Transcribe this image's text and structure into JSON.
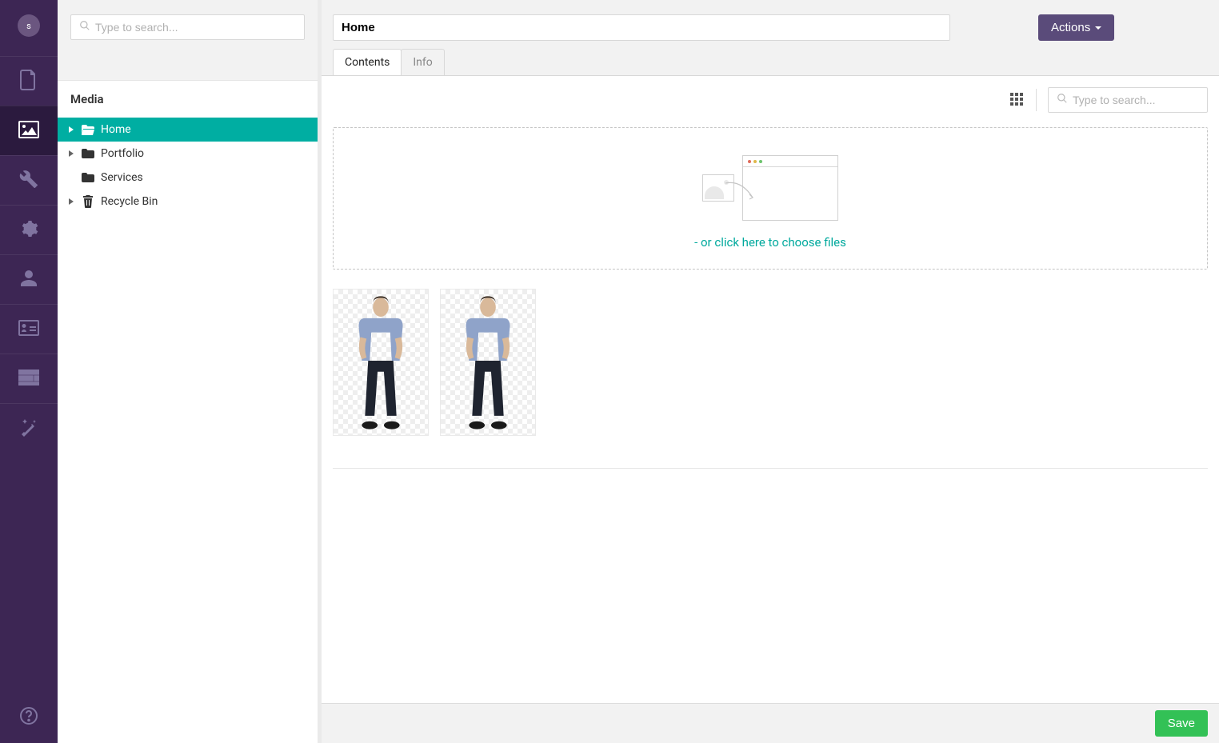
{
  "avatar_initial": "s",
  "sidebar_search_placeholder": "Type to search...",
  "main_search_placeholder": "Type to search...",
  "section_title": "Media",
  "tree": {
    "items": [
      {
        "label": "Home",
        "icon": "folder-open",
        "selected": true,
        "expandable": true
      },
      {
        "label": "Portfolio",
        "icon": "folder",
        "selected": false,
        "expandable": true
      },
      {
        "label": "Services",
        "icon": "folder",
        "selected": false,
        "expandable": false
      },
      {
        "label": "Recycle Bin",
        "icon": "trash",
        "selected": false,
        "expandable": true
      }
    ]
  },
  "title_value": "Home",
  "actions_label": "Actions",
  "tabs": [
    {
      "label": "Contents",
      "active": true
    },
    {
      "label": "Info",
      "active": false
    }
  ],
  "dropzone_link_text": "- or click here to choose files",
  "save_label": "Save",
  "colors": {
    "brand_dark": "#3d2654",
    "accent_teal": "#00aea2",
    "action_purple": "#5a4b7a",
    "save_green": "#33c156"
  }
}
